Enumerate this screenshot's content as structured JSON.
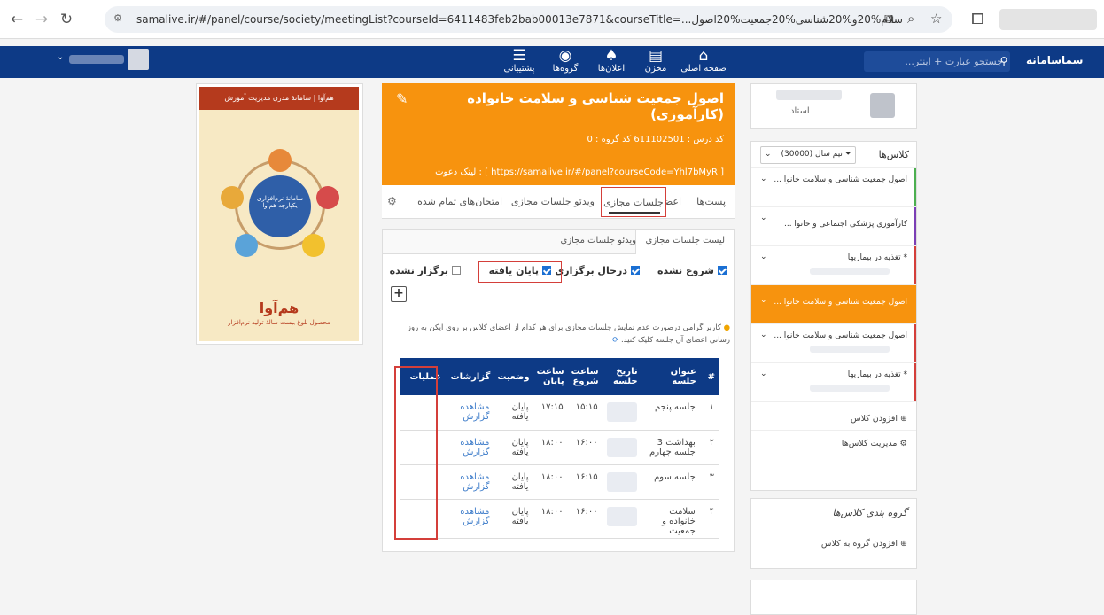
{
  "browser": {
    "url_text": "samalive.ir/#/panel/course/society/meetingList?courseId=6411483feb2bab00013e7871&courseTitle=...سلام%20و%20شناسی%20جمعیت%20اصول"
  },
  "topnav": {
    "search_placeholder": "جستجو عبارت + اینتر...",
    "logo": "سماسامانه",
    "items": [
      {
        "label": "صفحه اصلی",
        "icon": "home-icon"
      },
      {
        "label": "مخزن",
        "icon": "book-icon"
      },
      {
        "label": "اعلان‌ها",
        "icon": "bell-icon"
      },
      {
        "label": "گروه‌ها",
        "icon": "globe-icon"
      },
      {
        "label": "پشتیبانی",
        "icon": "rss-icon"
      }
    ]
  },
  "ad": {
    "header": "هم‌آوا | سامانۀ مدرن مدیریت آموزش",
    "center": "سامانۀ نرم‌افزاری یکپارچه هم‌آوا",
    "title": "هم‌آوا",
    "subtitle": "محصول بلوغ بیست سالۀ تولید نرم‌افزار"
  },
  "course": {
    "title": "اصول جمعیت شناسی و سلامت خانواده (کارآموزی)",
    "meta": "کد درس : 611102501   کد گروه : 0",
    "invite": "لینک دعوت : [ https://samalive.ir/#/panel?courseCode=Yhl7bMyR ]",
    "tabs": [
      "پست‌ها",
      "اعضا",
      "جلسات مجازی",
      "ویدئو جلسات مجازی",
      "امتحان‌های تمام شده"
    ]
  },
  "sessions": {
    "subtabs": [
      "لیست جلسات مجازی",
      "ویدئو جلسات مجازی"
    ],
    "filters": [
      {
        "label": "شروع نشده",
        "checked": true
      },
      {
        "label": "درحال برگزاری",
        "checked": true
      },
      {
        "label": "پایان یافته",
        "checked": true
      },
      {
        "label": "برگزار نشده",
        "checked": false
      }
    ],
    "notice": "کاربر گرامی درصورت عدم نمایش جلسات مجازی برای هر کدام از اعضای کلاس بر روی آیکن به روز رسانی اعضای آن جلسه کلیک کنید.",
    "columns": [
      "#",
      "عنوان جلسه",
      "تاریخ جلسه",
      "ساعت شروع",
      "ساعت پایان",
      "وضعیت",
      "گزارشات",
      "عملیات"
    ],
    "rows": [
      {
        "n": "۱",
        "title": "جلسه پنجم",
        "start": "۱۵:۱۵",
        "end": "۱۷:۱۵",
        "status": "پایان یافته",
        "report": "مشاهده گزارش"
      },
      {
        "n": "۲",
        "title": "بهداشت 3 جلسه چهارم",
        "start": "۱۶:۰۰",
        "end": "۱۸:۰۰",
        "status": "پایان یافته",
        "report": "مشاهده گزارش"
      },
      {
        "n": "۳",
        "title": "جلسه سوم",
        "start": "۱۶:۱۵",
        "end": "۱۸:۰۰",
        "status": "پایان یافته",
        "report": "مشاهده گزارش"
      },
      {
        "n": "۴",
        "title": "سلامت خانواده و جمعیت",
        "start": "۱۶:۰۰",
        "end": "۱۸:۰۰",
        "status": "پایان یافته",
        "report": "مشاهده گزارش"
      }
    ]
  },
  "sidebar": {
    "role": "استاد",
    "classes_title": "کلاس‌ها",
    "filter": "نیم سال (30000)",
    "items": [
      {
        "label": "اصول جمعیت شناسی و سلامت خانوا ...",
        "color": "#4caf50"
      },
      {
        "label": "کارآموزی پزشکی اجتماعی و خانوا ...",
        "color": "#7b3fb5"
      },
      {
        "label": "* تغذیه در بیماریها",
        "color": "#d43f3a"
      },
      {
        "label": "اصول جمعیت شناسی و سلامت خانوا ...",
        "color": "#f7930e"
      },
      {
        "label": "اصول جمعیت شناسی و سلامت خانوا ...",
        "color": "#d43f3a"
      },
      {
        "label": "* تغذیه در بیماریها",
        "color": "#d43f3a"
      }
    ],
    "add_class": "افزودن کلاس",
    "manage_classes": "مدیریت کلاس‌ها",
    "groups_title": "گروه بندی کلاس‌ها",
    "add_group": "افزودن گروه به کلاس"
  }
}
